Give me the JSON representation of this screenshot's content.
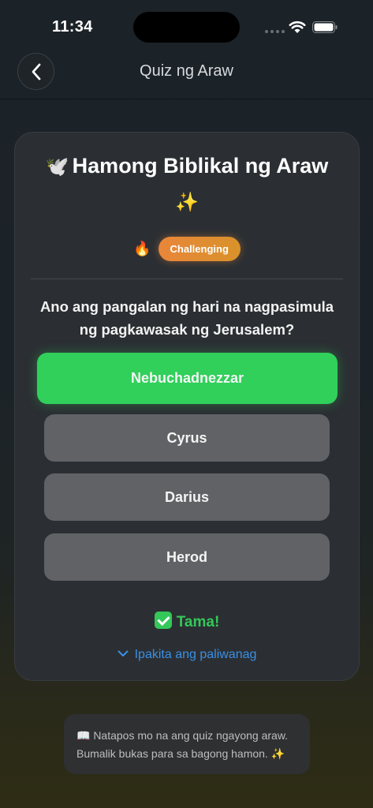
{
  "status_bar": {
    "time": "11:34"
  },
  "nav": {
    "title": "Quiz ng Araw"
  },
  "quiz": {
    "title": "Hamong Biblikal ng Araw",
    "title_emoji": "🕊️",
    "sparkles": "✨",
    "difficulty_emoji": "🔥",
    "difficulty": "Challenging",
    "question": "Ano ang pangalan ng hari na nagpasimula ng pagkawasak ng Jerusalem?",
    "options": [
      {
        "label": "Nebuchadnezzar",
        "state": "correct"
      },
      {
        "label": "Cyrus",
        "state": "default"
      },
      {
        "label": "Darius",
        "state": "default"
      },
      {
        "label": "Herod",
        "state": "default"
      }
    ],
    "result": "Tama!",
    "explanation_link": "Ipakita ang paliwanag"
  },
  "footer": {
    "line1": "📖 Natapos mo na ang quiz ngayong araw.",
    "line2": "Bumalik bukas para sa bagong hamon. ✨"
  },
  "colors": {
    "correct": "#30d05a",
    "option": "#606265",
    "badge": "#e8863a",
    "link": "#3a90e6"
  }
}
